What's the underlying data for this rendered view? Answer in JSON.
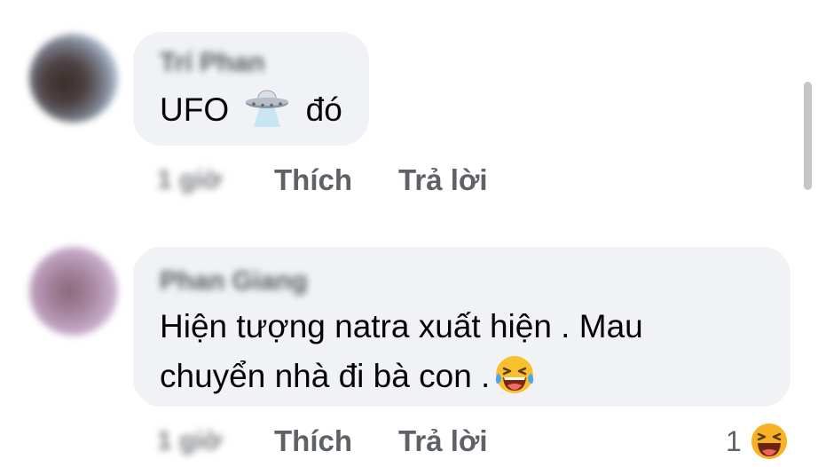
{
  "comments": [
    {
      "author": "Trí Phan",
      "text_before": "UFO",
      "emoji": "ufo-icon",
      "text_after": "đó",
      "time": "1 giờ",
      "like_label": "Thích",
      "reply_label": "Trả lời"
    },
    {
      "author": "Phan Giang",
      "line1": "Hiện tượng natra xuất hiện . Mau",
      "line2": "chuyển nhà đi bà con .",
      "emoji": "laughing-tears-icon",
      "time": "1 giờ",
      "like_label": "Thích",
      "reply_label": "Trả lời",
      "reaction_count": "1",
      "reaction_icon": "haha-reaction-icon"
    }
  ],
  "colors": {
    "bubble": "#f0f2f5",
    "text": "#050505",
    "secondary_text": "#5e6166",
    "reaction_yellow": "#f7b125"
  }
}
